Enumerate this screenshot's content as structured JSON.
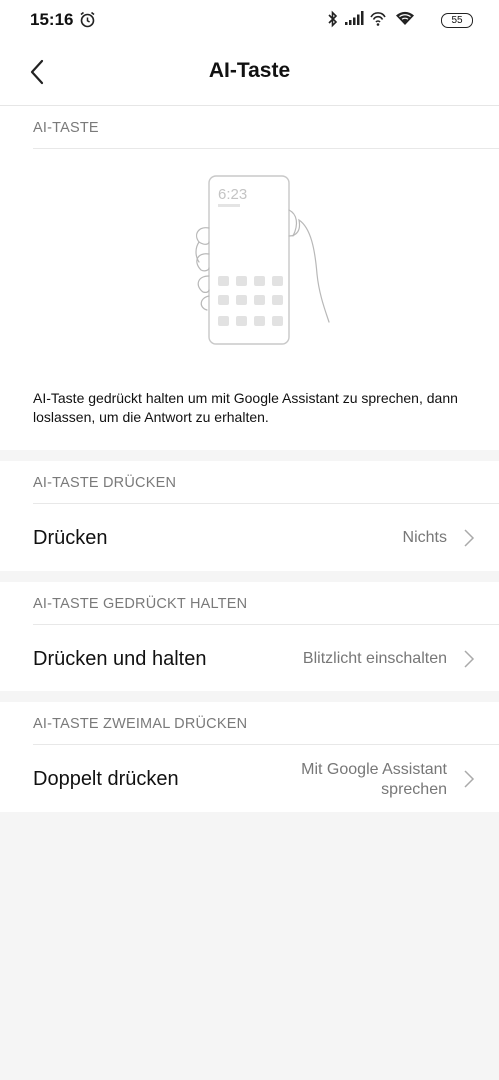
{
  "status_bar": {
    "time": "15:16",
    "battery": "55"
  },
  "header": {
    "title": "AI-Taste"
  },
  "intro": {
    "section_title": "AI-TASTE",
    "phone_time": "6:23",
    "description": "AI-Taste gedrückt halten um mit Google Assistant zu sprechen, dann loslassen, um die Antwort zu erhalten."
  },
  "press": {
    "section_title": "AI-TASTE DRÜCKEN",
    "label": "Drücken",
    "value": "Nichts"
  },
  "hold": {
    "section_title": "AI-TASTE GEDRÜCKT HALTEN",
    "label": "Drücken und halten",
    "value": "Blitzlicht einschalten"
  },
  "double": {
    "section_title": "AI-TASTE ZWEIMAL DRÜCKEN",
    "label": "Doppelt drücken",
    "value_line1": "Mit Google Assistant",
    "value_line2": "sprechen"
  }
}
